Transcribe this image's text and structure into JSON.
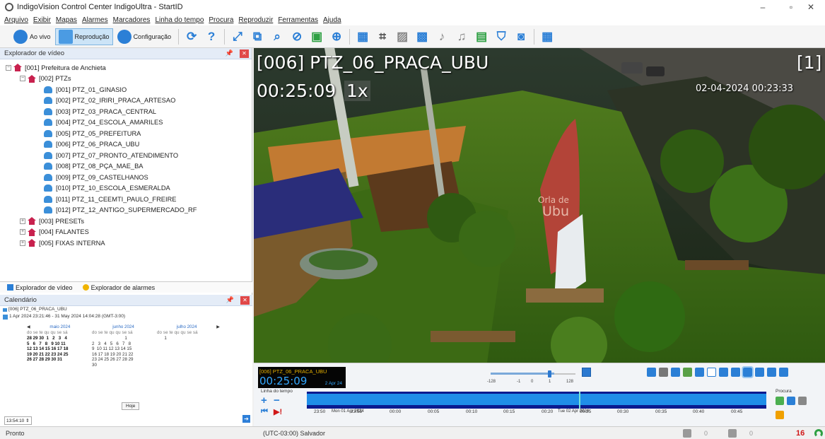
{
  "window": {
    "title": "IndigoVision Control Center IndigoUltra - StartID",
    "minimize": "–",
    "maximize": "▫",
    "close": "✕"
  },
  "menu": [
    "Arquivo",
    "Exibir",
    "Mapas",
    "Alarmes",
    "Marcadores",
    "Linha do tempo",
    "Procura",
    "Reproduzir",
    "Ferramentas",
    "Ajuda"
  ],
  "toolbar": {
    "live": "Ao vivo",
    "playback": "Reprodução",
    "config": "Configuração"
  },
  "explorer": {
    "title": "Explorador de vídeo",
    "root": "[001] Prefeitura de Anchieta",
    "group": "[002] PTZs",
    "cameras": [
      "[001] PTZ_01_GINASIO",
      "[002] PTZ_02_IRIRI_PRACA_ARTESAO",
      "[003] PTZ_03_PRACA_CENTRAL",
      "[004] PTZ_04_ESCOLA_AMARILES",
      "[005] PTZ_05_PREFEITURA",
      "[006] PTZ_06_PRACA_UBU",
      "[007] PTZ_07_PRONTO_ATENDIMENTO",
      "[008] PTZ_08_PÇA_MAE_BA",
      "[009] PTZ_09_CASTELHANOS",
      "[010] PTZ_10_ESCOLA_ESMERALDA",
      "[011] PTZ_11_CEEMTI_PAULO_FREIRE",
      "[012] PTZ_12_ANTIGO_SUPERMERCADO_RF"
    ],
    "others": [
      "[003] PRESETs",
      "[004] FALANTES",
      "[005] FIXAS INTERNA"
    ],
    "tab_video": "Explorador de vídeo",
    "tab_alarm": "Explorador de alarmes"
  },
  "calendar": {
    "title": "Calendário",
    "camera": "[006] PTZ_06_PRACA_UBU",
    "range": "1 Apr 2024 23:21:46 - 31 May 2024 14:04:28 (GMT-3:00)",
    "prev": "◀",
    "next": "▶",
    "days_header": "do se te qu qu se sá",
    "months": [
      {
        "name": "maio 2024",
        "weeks": [
          "28 29 30  1   2   3   4",
          "5   6   7   8   9 10 11",
          "12 13 14 15 16 17 18",
          "19 20 21 22 23 24 25",
          "26 27 28 29 30 31",
          ""
        ]
      },
      {
        "name": "junho 2024",
        "weeks": [
          "                           1",
          "2   3   4   5   6   7   8",
          "9  10 11 12 13 14 15",
          "16 17 18 19 20 21 22",
          "23 24 25 26 27 28 29",
          "30"
        ]
      },
      {
        "name": "julho 2024",
        "weeks": [
          "      1",
          "",
          "",
          "",
          "",
          ""
        ]
      }
    ],
    "today_button": "Hoje",
    "time": "13:54:10 ⇕"
  },
  "video": {
    "title_overlay": "[006] PTZ_06_PRACA_UBU",
    "time_overlay": "00:25:09",
    "speed_overlay": "1x",
    "slot": "[1]",
    "timestamp": "02-04-2024 00:23:33",
    "sign_text_1": "Orla de",
    "sign_text_2": "Ubu"
  },
  "playback": {
    "camera": "[006] PTZ_06_PRACA_UBU",
    "time": "00:25:09",
    "date": "2 Apr 24",
    "speed_labels": [
      "-128",
      "-1",
      "0",
      "1",
      "128"
    ],
    "speed_value": 1,
    "timeline_label": "Linha do tempo",
    "ticks": [
      "23:50",
      "23:55",
      "00:00",
      "00:05",
      "00:10",
      "00:15",
      "00:20",
      "00:25",
      "00:30",
      "00:35",
      "00:40",
      "00:45"
    ],
    "date_left": "Mon 01 Apr 2024",
    "date_right": "Tue 02 Apr 2024",
    "search_label": "Procura"
  },
  "status": {
    "text": "Pronto",
    "timezone": "(UTC-03:00) Salvador",
    "count_a": "0",
    "count_b": "0",
    "alarms": "16"
  },
  "colors": {
    "accent": "#2b7fd6",
    "alarm": "#d01818",
    "timeline_dark": "#0a1a8f",
    "timeline_light": "#1f8ee8"
  }
}
